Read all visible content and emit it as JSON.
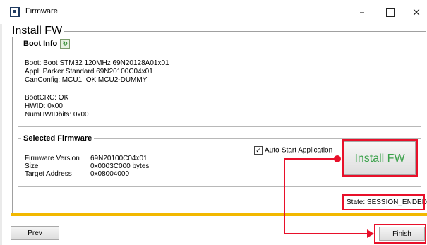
{
  "window": {
    "title": "Firmware",
    "min_glyph": "–",
    "close_glyph": "×"
  },
  "install": {
    "legend": "Install FW"
  },
  "boot_info": {
    "legend": "Boot Info",
    "refresh_icon_glyph": "↻",
    "lines": [
      "Boot: Boot STM32 120MHz 69N20128A01x01",
      "Appl: Parker Standard 69N20100C04x01",
      "CanConfig: MCU1: OK MCU2-DUMMY",
      "",
      "BootCRC: OK",
      "HWID: 0x00",
      "NumHWIDbits: 0x00"
    ]
  },
  "selected_firmware": {
    "legend": "Selected Firmware",
    "rows": [
      {
        "label": "Firmware Version",
        "value": "69N20100C04x01"
      },
      {
        "label": "Size",
        "value": "0x0003C000 bytes"
      },
      {
        "label": "Target Address",
        "value": "0x08004000"
      }
    ]
  },
  "auto_start": {
    "label": "Auto-Start Application",
    "checked": true,
    "check_glyph": "✓"
  },
  "install_button": {
    "label": "Install FW"
  },
  "state": {
    "text": "State: SESSION_ENDED"
  },
  "progress": {
    "percent": 100,
    "color": "#f2b800"
  },
  "buttons": {
    "prev": "Prev",
    "finish": "Finish"
  },
  "annotation": {
    "color": "#e8102a"
  }
}
